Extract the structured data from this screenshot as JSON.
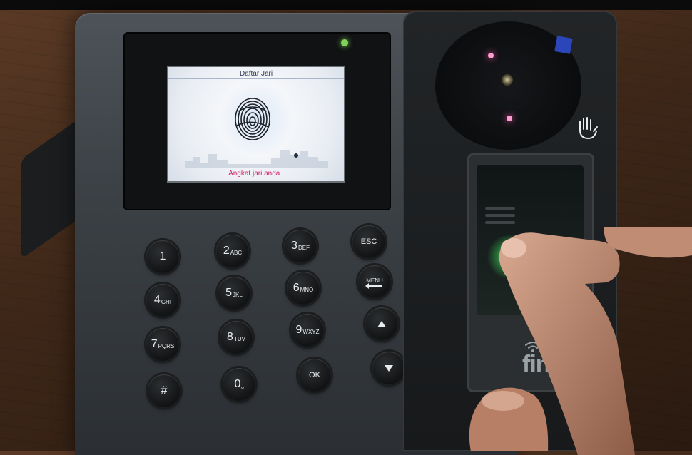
{
  "lcd": {
    "title": "Daftar Jari",
    "status": "Angkat jari anda !"
  },
  "keypad": {
    "k1": {
      "digit": "1",
      "letters": ""
    },
    "k2": {
      "digit": "2",
      "letters": "ABC"
    },
    "k3": {
      "digit": "3",
      "letters": "DEF"
    },
    "k4": {
      "digit": "4",
      "letters": "GHI"
    },
    "k5": {
      "digit": "5",
      "letters": "JKL"
    },
    "k6": {
      "digit": "6",
      "letters": "MNO"
    },
    "k7": {
      "digit": "7",
      "letters": "PQRS"
    },
    "k8": {
      "digit": "8",
      "letters": "TUV"
    },
    "k9": {
      "digit": "9",
      "letters": "WXYZ"
    },
    "k0": {
      "digit": "0",
      "letters": "⎵"
    },
    "hash": "#",
    "esc": "ESC",
    "menu": "MENU",
    "ok": "OK"
  },
  "brand": {
    "logo_text": "finge"
  },
  "colors": {
    "lcd_status": "#d0246a",
    "led_power": "#7fd35a",
    "sensor_glow": "#50ff6e",
    "ir_led": "#ff9bd0",
    "sticker": "#2b46b8"
  },
  "icons": [
    "fingerprint-icon",
    "hand-icon",
    "wifi-icon",
    "up-arrow-icon",
    "down-arrow-icon",
    "menu-arrow-icon"
  ]
}
